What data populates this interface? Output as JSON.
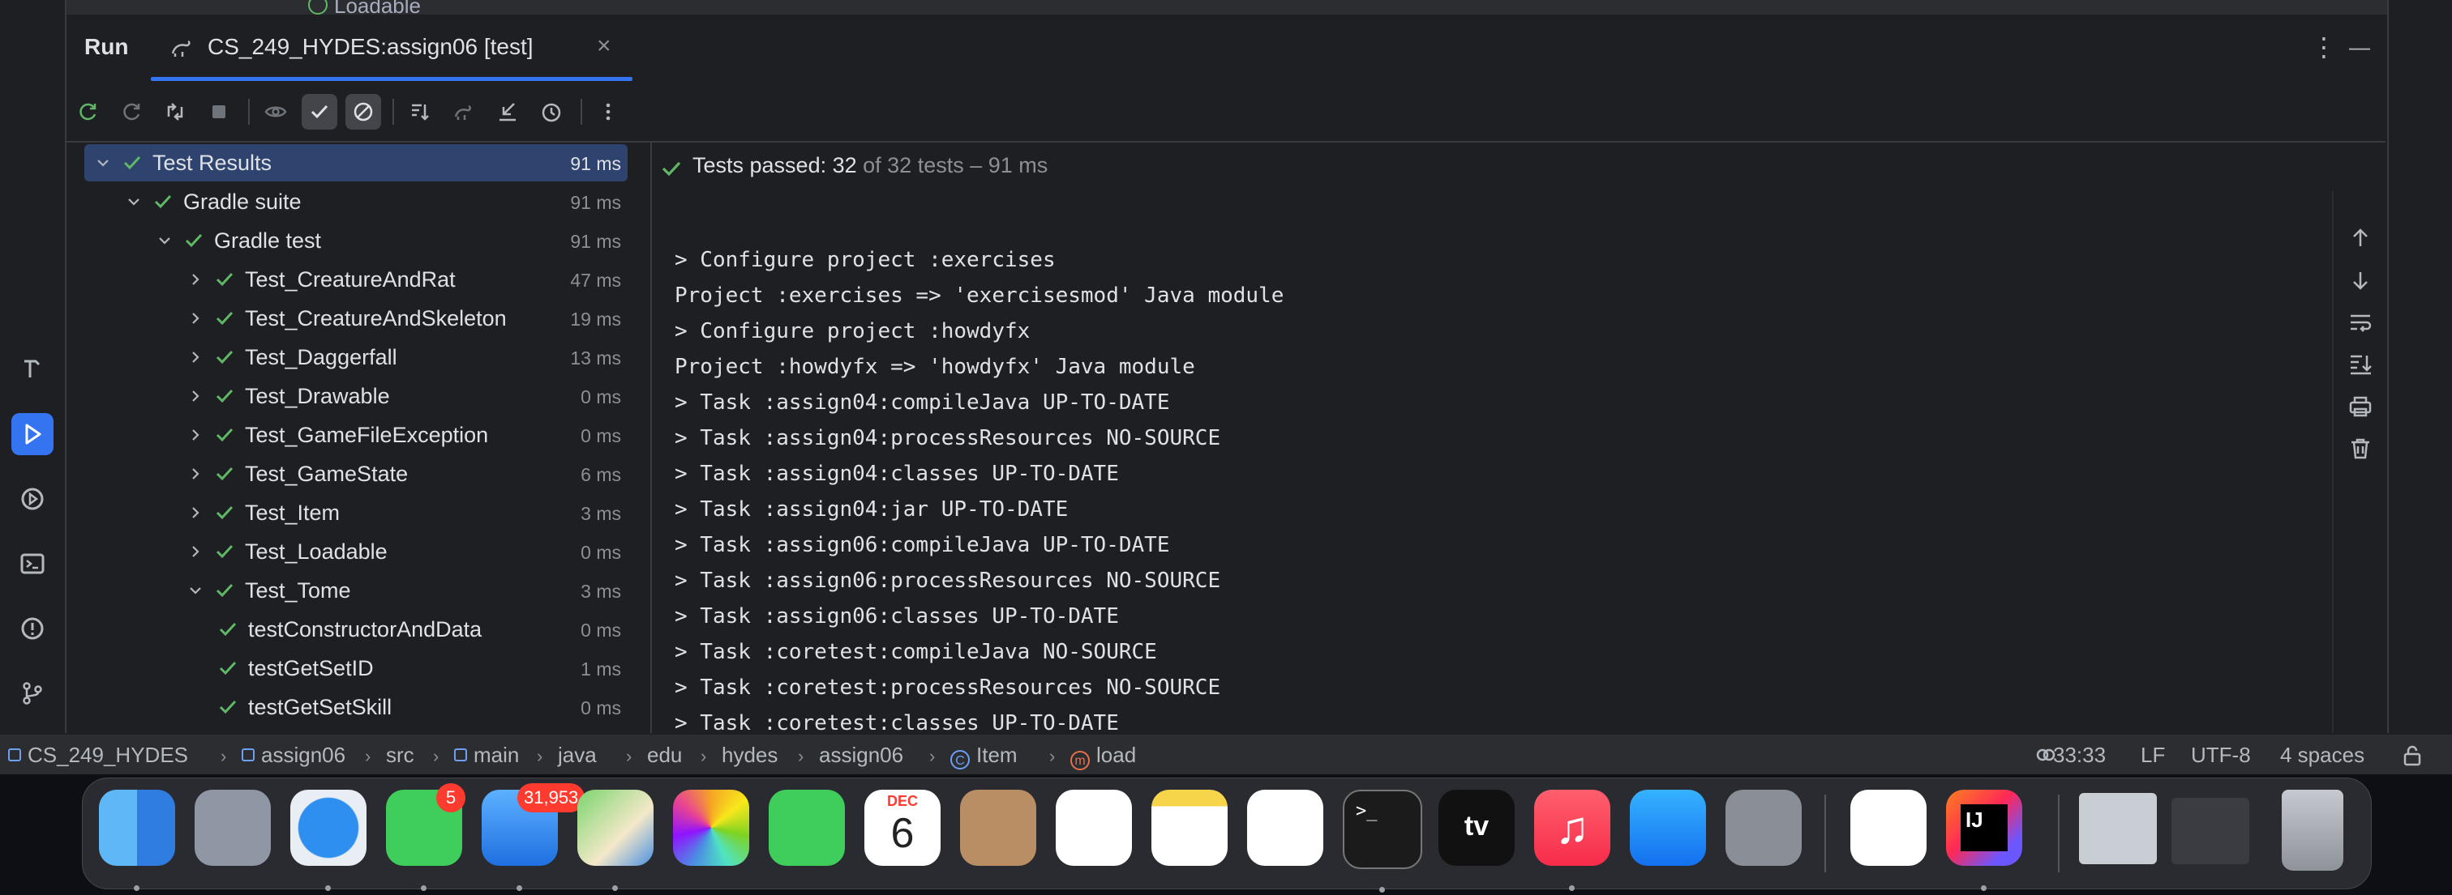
{
  "top_tab": {
    "label": "Loadable"
  },
  "tool_window": {
    "title": "Run",
    "tab_label": "CS_249_HYDES:assign06 [test]",
    "close_glyph": "×",
    "more_glyph": "⋮",
    "minimize_glyph": "—"
  },
  "toolbar_icons": [
    "rerun-icon",
    "rerun-failed-icon",
    "toggle-auto-test-icon",
    "stop-icon",
    "show-passed-eye-icon",
    "show-passed-check-icon",
    "show-ignored-icon",
    "sort-icon",
    "import-tests-icon",
    "collapse-icon",
    "history-icon",
    "more-icon"
  ],
  "tree": [
    {
      "name": "Test Results",
      "time": "91 ms",
      "level": 0,
      "expanded": true,
      "selected": true
    },
    {
      "name": "Gradle suite",
      "time": "91 ms",
      "level": 1,
      "expanded": true
    },
    {
      "name": "Gradle test",
      "time": "91 ms",
      "level": 2,
      "expanded": true
    },
    {
      "name": "Test_CreatureAndRat",
      "time": "47 ms",
      "level": 3,
      "expanded": false
    },
    {
      "name": "Test_CreatureAndSkeleton",
      "time": "19 ms",
      "level": 3,
      "expanded": false
    },
    {
      "name": "Test_Daggerfall",
      "time": "13 ms",
      "level": 3,
      "expanded": false
    },
    {
      "name": "Test_Drawable",
      "time": "0 ms",
      "level": 3,
      "expanded": false
    },
    {
      "name": "Test_GameFileException",
      "time": "0 ms",
      "level": 3,
      "expanded": false
    },
    {
      "name": "Test_GameState",
      "time": "6 ms",
      "level": 3,
      "expanded": false
    },
    {
      "name": "Test_Item",
      "time": "3 ms",
      "level": 3,
      "expanded": false
    },
    {
      "name": "Test_Loadable",
      "time": "0 ms",
      "level": 3,
      "expanded": false
    },
    {
      "name": "Test_Tome",
      "time": "3 ms",
      "level": 3,
      "expanded": true
    },
    {
      "name": "testConstructorAndData",
      "time": "0 ms",
      "level": 4,
      "leaf": true
    },
    {
      "name": "testGetSetID",
      "time": "1 ms",
      "level": 4,
      "leaf": true
    },
    {
      "name": "testGetSetSkill",
      "time": "0 ms",
      "level": 4,
      "leaf": true
    }
  ],
  "console": {
    "status_passed": "Tests passed: 32",
    "status_rest": "of 32 tests – 91 ms",
    "lines": [
      "> Configure project :exercises",
      "Project :exercises => 'exercisesmod' Java module",
      "> Configure project :howdyfx",
      "Project :howdyfx => 'howdyfx' Java module",
      "> Task :assign04:compileJava UP-TO-DATE",
      "> Task :assign04:processResources NO-SOURCE",
      "> Task :assign04:classes UP-TO-DATE",
      "> Task :assign04:jar UP-TO-DATE",
      "> Task :assign06:compileJava UP-TO-DATE",
      "> Task :assign06:processResources NO-SOURCE",
      "> Task :assign06:classes UP-TO-DATE",
      "> Task :coretest:compileJava NO-SOURCE",
      "> Task :coretest:processResources NO-SOURCE",
      "> Task :coretest:classes UP-TO-DATE"
    ],
    "side_icons": [
      "arrow-up-icon",
      "arrow-down-icon",
      "soft-wrap-icon",
      "scroll-to-end-icon",
      "print-icon",
      "clear-all-icon"
    ]
  },
  "left_stripe_icons": [
    "build-hammer-icon",
    "run-icon",
    "services-icon",
    "terminal-icon",
    "problems-icon",
    "git-icon"
  ],
  "breadcrumbs": [
    "CS_249_HYDES",
    "assign06",
    "src",
    "main",
    "java",
    "edu",
    "hydes",
    "assign06",
    "Item",
    "load"
  ],
  "status_right": {
    "position": "33:33",
    "line_ending": "LF",
    "encoding": "UTF-8",
    "indent": "4 spaces"
  },
  "dock": {
    "apps": [
      {
        "name": "finder-icon",
        "badge": ""
      },
      {
        "name": "launchpad-icon",
        "badge": ""
      },
      {
        "name": "safari-icon",
        "badge": ""
      },
      {
        "name": "messages-icon",
        "badge": "5"
      },
      {
        "name": "mail-icon",
        "badge": "31,953"
      },
      {
        "name": "maps-icon",
        "badge": ""
      },
      {
        "name": "photos-icon",
        "badge": ""
      },
      {
        "name": "facetime-icon",
        "badge": ""
      },
      {
        "name": "calendar-icon",
        "badge": ""
      },
      {
        "name": "contacts-icon",
        "badge": ""
      },
      {
        "name": "reminders-icon",
        "badge": ""
      },
      {
        "name": "notes-icon",
        "badge": ""
      },
      {
        "name": "freeform-icon",
        "badge": ""
      },
      {
        "name": "terminal-app-icon",
        "badge": ""
      },
      {
        "name": "apple-tv-icon",
        "badge": ""
      },
      {
        "name": "music-icon",
        "badge": ""
      },
      {
        "name": "app-store-icon",
        "badge": ""
      },
      {
        "name": "system-settings-icon",
        "badge": ""
      },
      {
        "name": "textedit-icon",
        "badge": ""
      },
      {
        "name": "intellij-idea-icon",
        "badge": ""
      }
    ],
    "calendar_month": "DEC",
    "calendar_day": "6",
    "tv_label": "tv",
    "ij_label": "IJ"
  }
}
